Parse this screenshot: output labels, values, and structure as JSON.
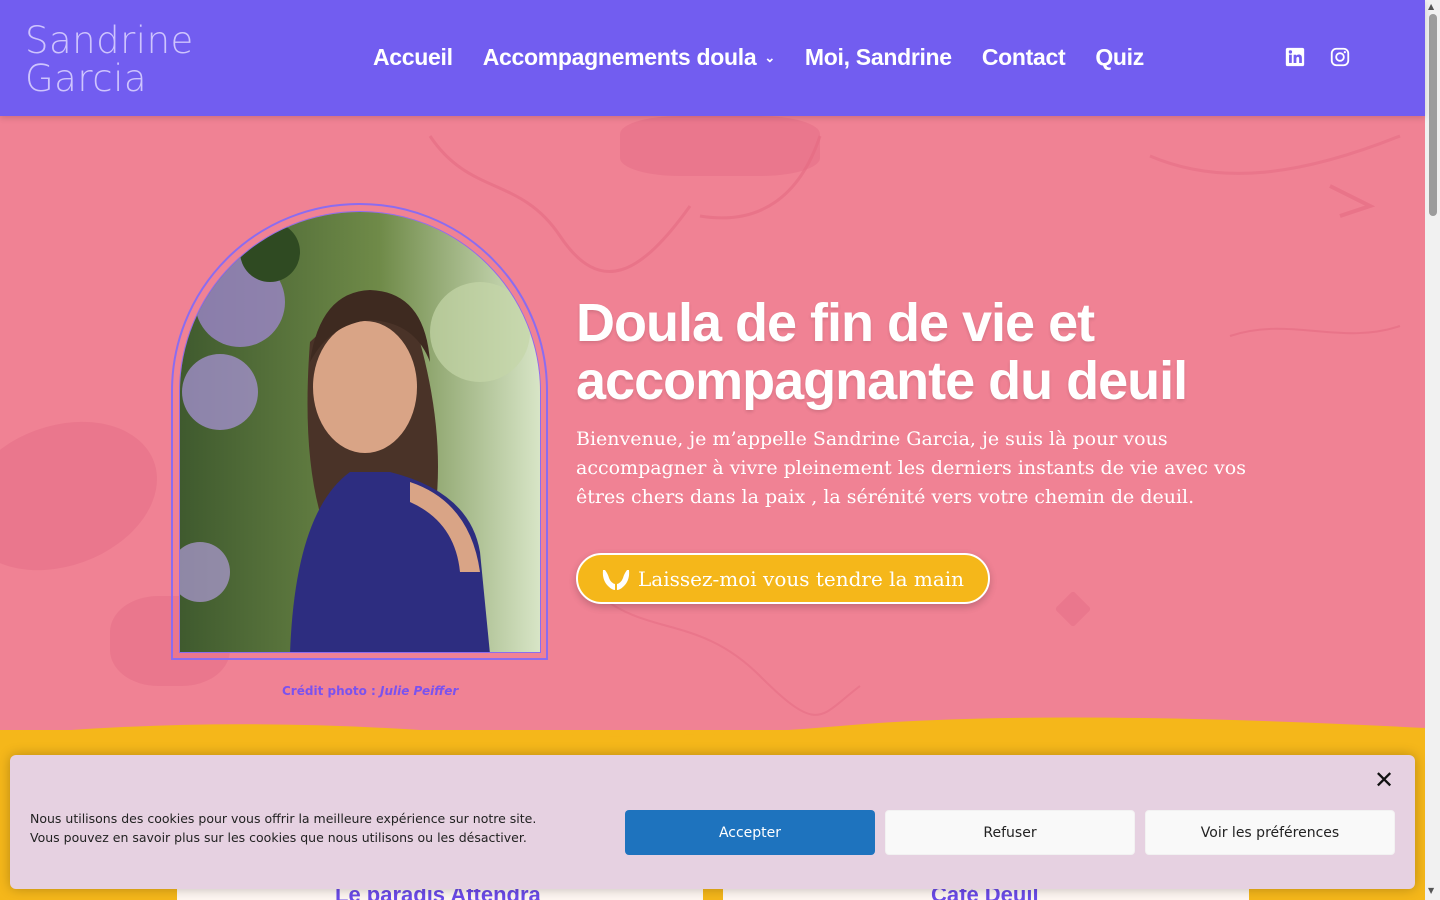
{
  "header": {
    "logo_line1": "Sandrine",
    "logo_line2": "Garcia",
    "nav": [
      {
        "label": "Accueil"
      },
      {
        "label": "Accompagnements doula"
      },
      {
        "label": "Moi, Sandrine"
      },
      {
        "label": "Contact"
      },
      {
        "label": "Quiz"
      }
    ],
    "social": [
      "linkedin-icon",
      "instagram-icon"
    ]
  },
  "hero": {
    "title": "Doula de fin de vie et accompagnante du deuil",
    "text": "Bienvenue, je m’appelle Sandrine Garcia,  je suis là pour vous accompagner à vivre pleinement les derniers instants de vie avec vos êtres chers dans la paix , la sérénité vers votre chemin de deuil.",
    "cta_label": "Laissez-moi vous tendre la main",
    "cta_icon": "open-hands-icon",
    "credit_label": "Crédit photo : ",
    "credit_name": "Julie Peiffer"
  },
  "cards": [
    {
      "title": "Le paradis Attendra"
    },
    {
      "title": "Café Deuil"
    }
  ],
  "cookie": {
    "text_line1": "Nous utilisons des cookies pour vous offrir la meilleure expérience sur notre site.",
    "text_line2": "Vous pouvez en savoir plus sur les cookies que nous utilisons ou les désactiver.",
    "accept": "Accepter",
    "refuse": "Refuser",
    "prefs": "Voir les préférences",
    "close": "✕"
  },
  "colors": {
    "header": "#725df0",
    "hero": "#f08294",
    "cta": "#f5b71a",
    "accept": "#1e73be"
  }
}
